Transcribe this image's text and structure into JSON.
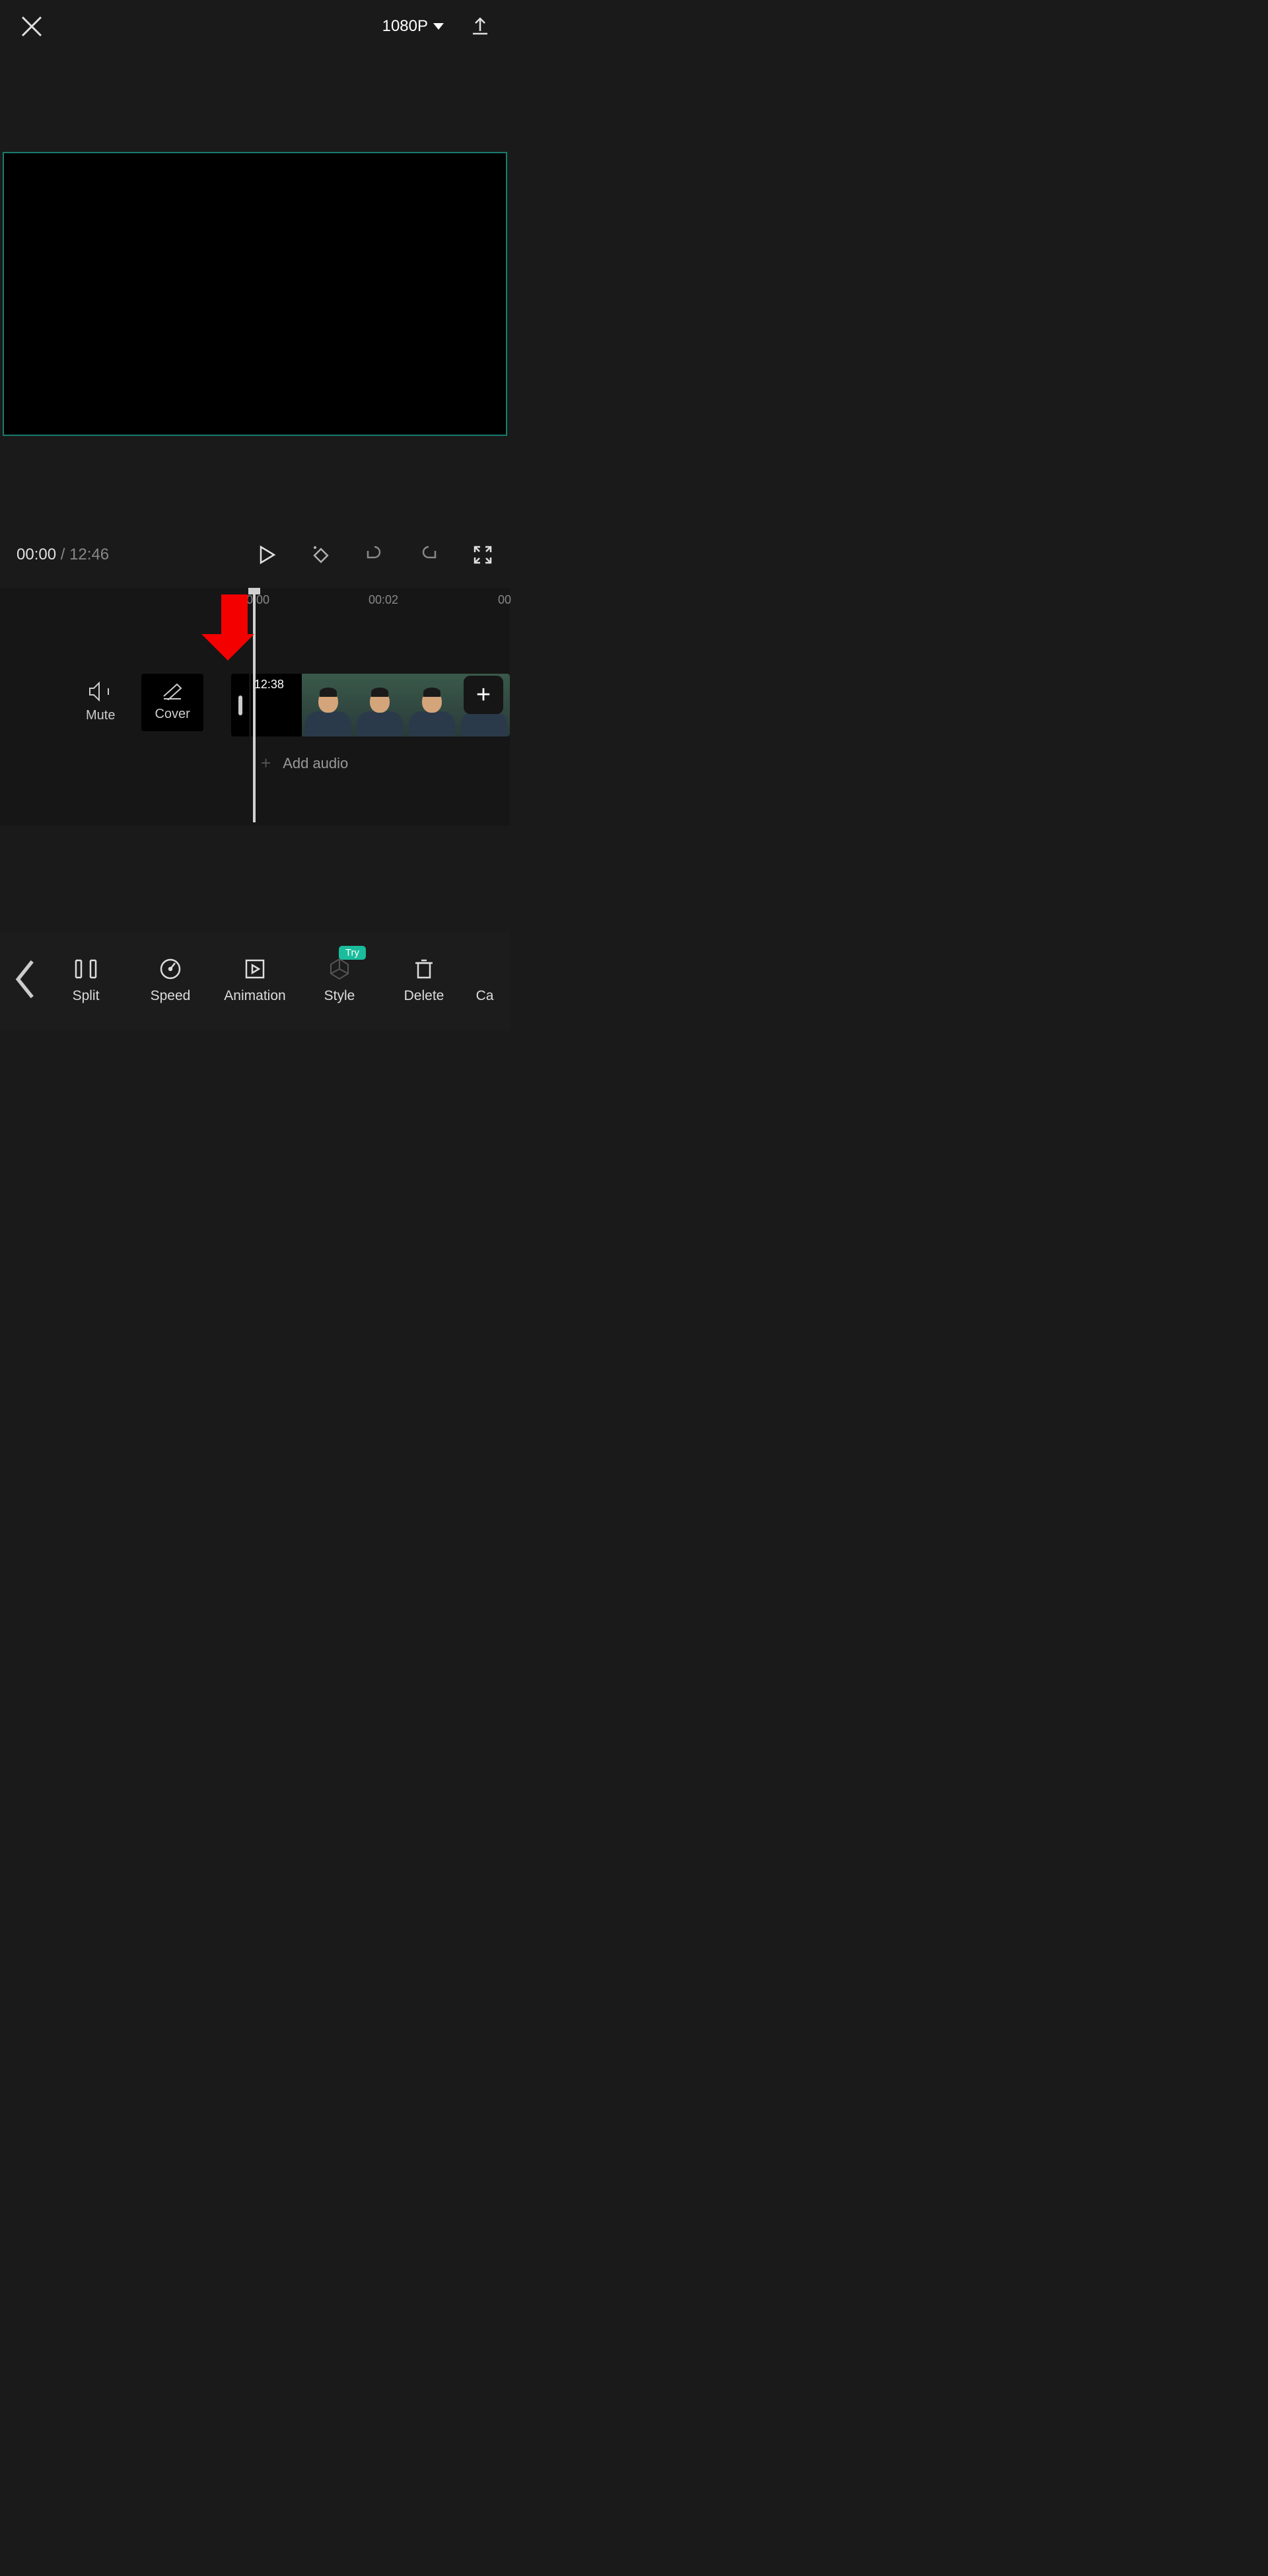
{
  "header": {
    "resolution": "1080P"
  },
  "playback": {
    "current": "00:00",
    "separator": " / ",
    "total": "12:46"
  },
  "ruler": {
    "marks": [
      "00:00",
      "00:02",
      "00"
    ]
  },
  "track": {
    "mute_label": "Mute",
    "cover_label": "Cover",
    "clip_duration": "12:38",
    "add_audio_label": "Add audio"
  },
  "toolbar": {
    "split": "Split",
    "speed": "Speed",
    "animation": "Animation",
    "style": "Style",
    "style_badge": "Try",
    "delete": "Delete",
    "camera_partial": "Ca"
  }
}
